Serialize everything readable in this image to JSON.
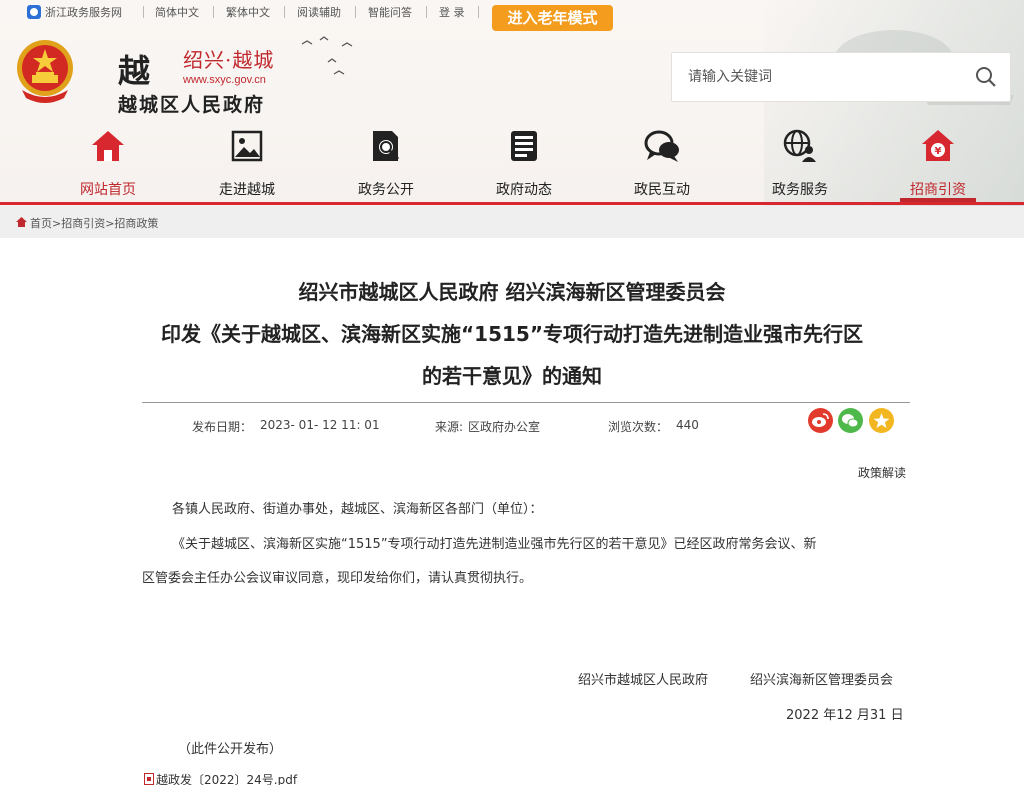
{
  "topbar": {
    "zj_service": "浙江政务服务网",
    "simplified": "简体中文",
    "traditional": "繁体中文",
    "reading_aid": "阅读辅助",
    "smart_qa": "智能问答",
    "login": "登 录",
    "elder_mode": "进入老年模式"
  },
  "logo": {
    "mark": "越",
    "title": "绍兴·越城",
    "url": "www.sxyc.gov.cn",
    "subtitle": "越城区人民政府"
  },
  "search": {
    "placeholder": "请输入关键词"
  },
  "nav": {
    "items": [
      {
        "label": "网站首页",
        "icon": "home-icon"
      },
      {
        "label": "走进越城",
        "icon": "picture-icon"
      },
      {
        "label": "政务公开",
        "icon": "document-search-icon"
      },
      {
        "label": "政府动态",
        "icon": "news-icon"
      },
      {
        "label": "政民互动",
        "icon": "chat-icon"
      },
      {
        "label": "政务服务",
        "icon": "globe-user-icon"
      },
      {
        "label": "招商引资",
        "icon": "yuan-house-icon"
      }
    ],
    "accent": "#c0282e"
  },
  "breadcrumb": "首页>招商引资>招商政策",
  "article": {
    "title_line1": "绍兴市越城区人民政府 绍兴滨海新区管理委员会",
    "title_line2": "印发《关于越城区、滨海新区实施“1515”专项行动打造先进制造业强市先行区",
    "title_line3": "的若干意见》的通知",
    "publish_date_label": "发布日期：",
    "publish_date": "2023- 01- 12 11: 01",
    "source_label": "来源: ",
    "source": "区政府办公室",
    "views_label": "浏览次数：",
    "views": "440",
    "policy_link": "政策解读",
    "para1": "各镇人民政府、街道办事处，越城区、滨海新区各部门（单位）：",
    "para2": "《关于越城区、滨海新区实施“1515”专项行动打造先进制造业强市先行区的若干意见》已经区政府常务会议、新",
    "para3": "区管委会主任办公会议审议同意，现印发给你们，请认真贯彻执行。",
    "sign_gov": "绍兴市越城区人民政府",
    "sign_committee": "绍兴滨海新区管理委员会",
    "sign_date": "2022 年12 月31 日",
    "publish_note": "（此件公开发布）",
    "attachment": "越政发〔2022〕24号.pdf"
  },
  "colors": {
    "brand_red": "#d7282f",
    "elder_orange": "#f39c1e",
    "weibo": "#e23b2e",
    "wechat": "#4fb84a",
    "favorite": "#f2b620"
  }
}
